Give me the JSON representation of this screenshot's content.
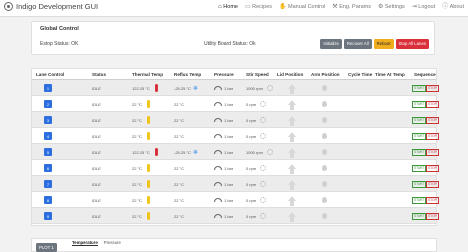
{
  "app": {
    "title": "Indigo Development GUI",
    "logo_icon": "indigo-logo-icon"
  },
  "nav": [
    {
      "id": "home",
      "label": "Home",
      "icon": "house-icon",
      "glyph": "⌂",
      "active": true
    },
    {
      "id": "recipes",
      "label": "Recipes",
      "icon": "book-icon",
      "glyph": "▭",
      "active": false
    },
    {
      "id": "manual",
      "label": "Manual Control",
      "icon": "hand-icon",
      "glyph": "✋",
      "active": false
    },
    {
      "id": "eng",
      "label": "Eng. Params",
      "icon": "wrench-icon",
      "glyph": "⚒",
      "active": false
    },
    {
      "id": "settings",
      "label": "Settings",
      "icon": "gear-icon",
      "glyph": "⚙",
      "active": false
    },
    {
      "id": "logout",
      "label": "Logout",
      "icon": "logout-icon",
      "glyph": "⇥",
      "active": false
    },
    {
      "id": "about",
      "label": "About",
      "icon": "info-icon",
      "glyph": "ⓘ",
      "active": false
    }
  ],
  "global_control": {
    "title": "Global Control",
    "estop_status": "Estop Status: OK",
    "utility_status": "Utility Board Status: Ok",
    "buttons": [
      {
        "label": "Initialize",
        "style": "gray"
      },
      {
        "label": "Recover All",
        "style": "gray"
      },
      {
        "label": "Reboot",
        "style": "yellow"
      },
      {
        "label": "Stop All Lanes",
        "style": "red"
      }
    ]
  },
  "lanes": {
    "headers": [
      "Lane Control",
      "Status",
      "Thermal Temp",
      "Reflux Temp",
      "Pressure",
      "Stir Speed",
      "Lid Position",
      "Arm Position",
      "Cycle Time",
      "Time At Temp",
      "Sequence"
    ],
    "sequence_labels": {
      "start": "START",
      "stop": "STOP"
    },
    "rows": [
      {
        "lane": "1",
        "status": "IDLE",
        "thermal": "122.25 °C",
        "thermal_color": "#d9303c",
        "reflux": "-25.25 °C",
        "reflux_cold": true,
        "pressure": "1 bar",
        "stir": "1000 rpm"
      },
      {
        "lane": "2",
        "status": "IDLE",
        "thermal": "22 °C",
        "thermal_color": "#f0c419",
        "reflux": "22 °C",
        "reflux_cold": false,
        "pressure": "1 bar",
        "stir": "0 rpm"
      },
      {
        "lane": "3",
        "status": "IDLE",
        "thermal": "22 °C",
        "thermal_color": "#f0c419",
        "reflux": "22 °C",
        "reflux_cold": false,
        "pressure": "1 bar",
        "stir": "0 rpm"
      },
      {
        "lane": "4",
        "status": "IDLE",
        "thermal": "22 °C",
        "thermal_color": "#f0c419",
        "reflux": "22 °C",
        "reflux_cold": false,
        "pressure": "1 bar",
        "stir": "0 rpm"
      },
      {
        "lane": "5",
        "status": "IDLE",
        "thermal": "122.25 °C",
        "thermal_color": "#d9303c",
        "reflux": "-25.25 °C",
        "reflux_cold": true,
        "pressure": "1 bar",
        "stir": "1000 rpm"
      },
      {
        "lane": "6",
        "status": "IDLE",
        "thermal": "22 °C",
        "thermal_color": "#f0c419",
        "reflux": "22 °C",
        "reflux_cold": false,
        "pressure": "1 bar",
        "stir": "0 rpm"
      },
      {
        "lane": "7",
        "status": "IDLE",
        "thermal": "22 °C",
        "thermal_color": "#f0c419",
        "reflux": "22 °C",
        "reflux_cold": false,
        "pressure": "1 bar",
        "stir": "0 rpm"
      },
      {
        "lane": "8",
        "status": "IDLE",
        "thermal": "22 °C",
        "thermal_color": "#f0c419",
        "reflux": "22 °C",
        "reflux_cold": false,
        "pressure": "1 bar",
        "stir": "0 rpm"
      },
      {
        "lane": "9",
        "status": "IDLE",
        "thermal": "22 °C",
        "thermal_color": "#f0c419",
        "reflux": "22 °C",
        "reflux_cold": false,
        "pressure": "1 bar",
        "stir": "0 rpm"
      }
    ]
  },
  "plot": {
    "button_label": "PLOT 1",
    "tabs": [
      {
        "label": "Temperature",
        "active": true
      },
      {
        "label": "Pressure",
        "active": false
      }
    ]
  },
  "colors": {
    "lane_blue": "#2c6fe0",
    "snow_blue": "#3a8ee6",
    "start_green": "#3a9a3a",
    "stop_red": "#cc3333"
  }
}
